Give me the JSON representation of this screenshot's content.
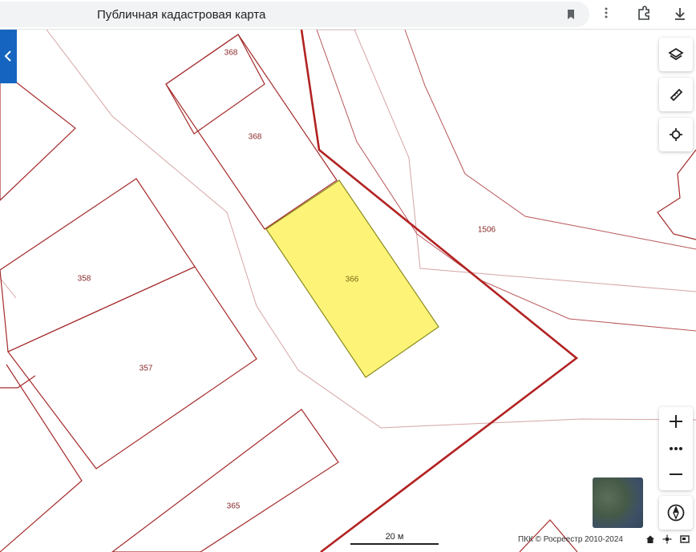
{
  "browser": {
    "page_title": "Публичная кадастровая карта",
    "icons": [
      "bookmark-icon",
      "more-vert-icon",
      "extension-icon",
      "download-icon"
    ]
  },
  "map": {
    "parcels": [
      {
        "id": "368-top",
        "label": "368",
        "selected": false
      },
      {
        "id": "368",
        "label": "368",
        "selected": false
      },
      {
        "id": "366",
        "label": "366",
        "selected": true
      },
      {
        "id": "1506",
        "label": "1506",
        "selected": false
      },
      {
        "id": "358",
        "label": "358",
        "selected": false
      },
      {
        "id": "357",
        "label": "357",
        "selected": false
      },
      {
        "id": "365",
        "label": "365",
        "selected": false
      }
    ],
    "colors": {
      "boundary": "#a52a2a",
      "boundary_thin": "#c98a8a",
      "quarter_boundary": "#b22222",
      "selected_fill": "#fdf477",
      "selected_stroke": "#8a8a20",
      "panel_tab": "#1565c0"
    },
    "scale_label": "20 м",
    "attribution": "ПКК © Росреестр 2010-2024",
    "controls": {
      "layers": "layers-icon",
      "measure": "ruler-icon",
      "locate": "locate-icon",
      "zoom_in": "plus-icon",
      "zoom_more": "more-horiz-icon",
      "zoom_out": "minus-icon",
      "compass": "compass-icon"
    }
  }
}
